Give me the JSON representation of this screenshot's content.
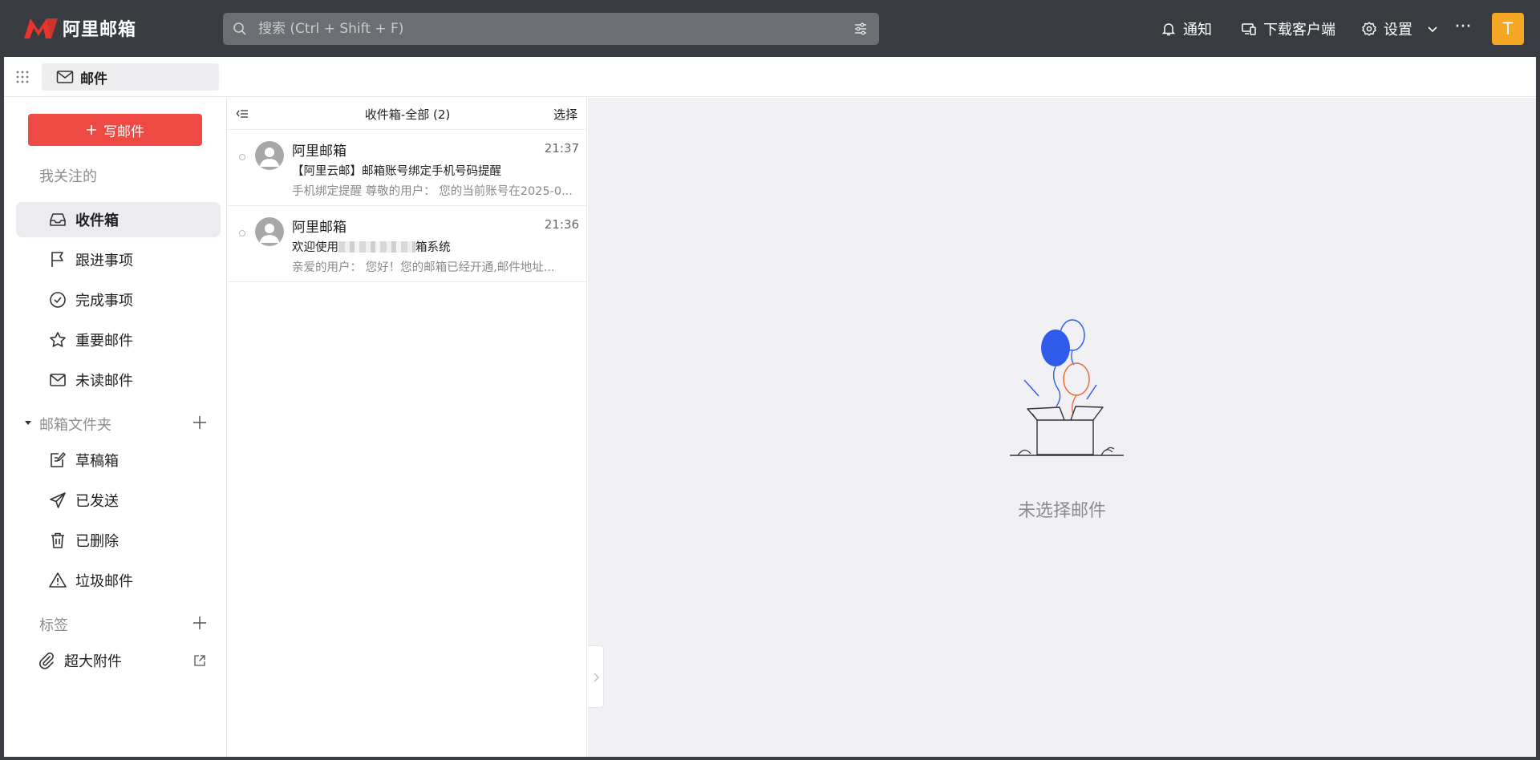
{
  "header": {
    "logo_text": "阿里邮箱",
    "search": {
      "placeholder": "搜索 (Ctrl + Shift + F)"
    },
    "nav": {
      "notify": "通知",
      "download": "下载客户端",
      "settings": "设置",
      "more": "···"
    },
    "avatar_letter": "T",
    "avatar_color": "#f5a623"
  },
  "appbar": {
    "active_app": "邮件"
  },
  "sidebar": {
    "compose_label": "写邮件",
    "followed_label": "我关注的",
    "followed_items": [
      {
        "label": "收件箱",
        "icon": "inbox-icon",
        "active": true
      },
      {
        "label": "跟进事项",
        "icon": "flag-icon"
      },
      {
        "label": "完成事项",
        "icon": "check-circle-icon"
      },
      {
        "label": "重要邮件",
        "icon": "star-icon"
      },
      {
        "label": "未读邮件",
        "icon": "envelope-icon"
      }
    ],
    "folders_label": "邮箱文件夹",
    "folder_items": [
      {
        "label": "草稿箱",
        "icon": "draft-icon"
      },
      {
        "label": "已发送",
        "icon": "send-icon"
      },
      {
        "label": "已删除",
        "icon": "trash-icon"
      },
      {
        "label": "垃圾邮件",
        "icon": "warning-icon"
      }
    ],
    "tags_label": "标签",
    "large_attachment_label": "超大附件"
  },
  "list": {
    "title": "收件箱-全部 (2)",
    "select_label": "选择",
    "messages": [
      {
        "sender": "阿里邮箱",
        "time": "21:37",
        "subject": "【阿里云邮】邮箱账号绑定手机号码提醒",
        "preview": "手机绑定提醒 尊敬的用户： 您的当前账号在2025-0..."
      },
      {
        "sender": "阿里邮箱",
        "time": "21:36",
        "subject_start": "欢迎使用",
        "subject_end": "箱系统",
        "preview": "亲爱的用户：  您好！您的邮箱已经开通,邮件地址..."
      }
    ]
  },
  "reading": {
    "empty_text": "未选择邮件"
  },
  "colors": {
    "topbar": "#383b40",
    "compose": "#ee4a43",
    "balloon_blue": "#2f5bea",
    "balloon_orange": "#f06b3c"
  }
}
